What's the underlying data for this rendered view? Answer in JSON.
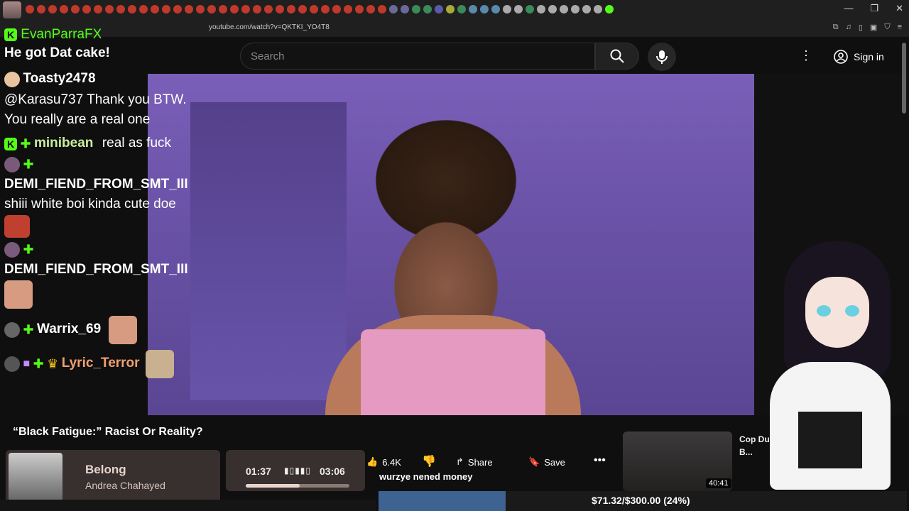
{
  "browser": {
    "url": "youtube.com/watch?v=QKTKI_YO4T8",
    "window_controls": [
      "—",
      "❐",
      "✕"
    ]
  },
  "youtube": {
    "search_placeholder": "Search",
    "sign_in": "Sign in"
  },
  "chat": {
    "streamer": "EvanParraFX",
    "top_message": "He got Dat cake!",
    "messages": [
      {
        "user": "Toasty2478",
        "text": "@Karasu737 Thank you BTW. You really are a real one"
      },
      {
        "user": "minibean",
        "text": "real as fuck"
      },
      {
        "user": "DEMI_FIEND_FROM_SMT_III",
        "text": "shiii white boi kinda cute doe"
      },
      {
        "user": "DEMI_FIEND_FROM_SMT_III",
        "text": ""
      },
      {
        "user": "Warrix_69",
        "text": ""
      },
      {
        "user": "Lyric_Terror",
        "text": ""
      }
    ]
  },
  "video": {
    "title": "“Black Fatigue:” Racist Or Reality?",
    "likes": "6.4K",
    "share": "Share",
    "save": "Save"
  },
  "music": {
    "song": "Belong",
    "artist": "Andrea Chahayed",
    "current_time": "01:37",
    "total_time": "03:06",
    "progress": 0.52
  },
  "overlay": {
    "caption": "wurzye nened money",
    "goal_text": "$71.32/$300.00 (24%)",
    "goal_progress": 0.24
  },
  "recommendation": {
    "title": "Cop Dum B...",
    "duration": "40:41"
  },
  "colors": {
    "kick_green": "#53fc18",
    "goal_fill": "#3e6390"
  }
}
